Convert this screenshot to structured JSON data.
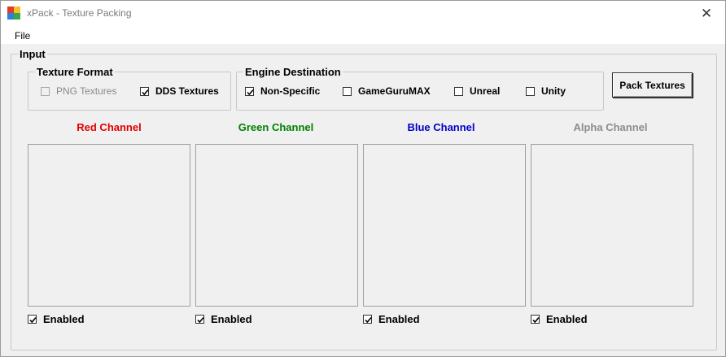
{
  "window": {
    "title": "xPack - Texture Packing",
    "close_glyph": "✕"
  },
  "menu": {
    "file": "File"
  },
  "input_group": {
    "label": "Input"
  },
  "texture_format": {
    "label": "Texture Format",
    "png": {
      "label": "PNG Textures",
      "checked": false,
      "enabled": false
    },
    "dds": {
      "label": "DDS Textures",
      "checked": true,
      "enabled": true
    }
  },
  "engine_destination": {
    "label": "Engine Destination",
    "non_specific": {
      "label": "Non-Specific",
      "checked": true
    },
    "gameguru": {
      "label": "GameGuruMAX",
      "checked": false
    },
    "unreal": {
      "label": "Unreal",
      "checked": false
    },
    "unity": {
      "label": "Unity",
      "checked": false
    }
  },
  "pack_button": {
    "label": "Pack Textures"
  },
  "channels": [
    {
      "label": "Red Channel",
      "color": "#e00000",
      "enabled_label": "Enabled",
      "enabled": true
    },
    {
      "label": "Green Channel",
      "color": "#008000",
      "enabled_label": "Enabled",
      "enabled": true
    },
    {
      "label": "Blue Channel",
      "color": "#0000c8",
      "enabled_label": "Enabled",
      "enabled": true
    },
    {
      "label": "Alpha Channel",
      "color": "#8c8c8c",
      "enabled_label": "Enabled",
      "enabled": true
    }
  ]
}
